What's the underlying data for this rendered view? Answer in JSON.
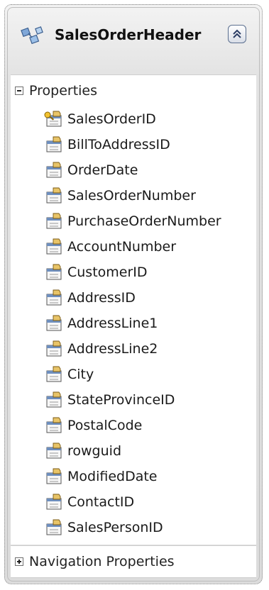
{
  "entity": {
    "title": "SalesOrderHeader",
    "icon": "entity-icon",
    "collapse_icon": "double-chevron-up-icon"
  },
  "properties_section": {
    "label": "Properties",
    "expanded": true,
    "items": [
      {
        "label": "SalesOrderID",
        "icon": "key-property-icon"
      },
      {
        "label": "BillToAddressID",
        "icon": "property-icon"
      },
      {
        "label": "OrderDate",
        "icon": "property-icon"
      },
      {
        "label": "SalesOrderNumber",
        "icon": "property-icon"
      },
      {
        "label": "PurchaseOrderNumber",
        "icon": "property-icon"
      },
      {
        "label": "AccountNumber",
        "icon": "property-icon"
      },
      {
        "label": "CustomerID",
        "icon": "property-icon"
      },
      {
        "label": "AddressID",
        "icon": "property-icon"
      },
      {
        "label": "AddressLine1",
        "icon": "property-icon"
      },
      {
        "label": "AddressLine2",
        "icon": "property-icon"
      },
      {
        "label": "City",
        "icon": "property-icon"
      },
      {
        "label": "StateProvinceID",
        "icon": "property-icon"
      },
      {
        "label": "PostalCode",
        "icon": "property-icon"
      },
      {
        "label": "rowguid",
        "icon": "property-icon"
      },
      {
        "label": "ModifiedDate",
        "icon": "property-icon"
      },
      {
        "label": "ContactID",
        "icon": "property-icon"
      },
      {
        "label": "SalesPersonID",
        "icon": "property-icon"
      }
    ]
  },
  "navigation_section": {
    "label": "Navigation Properties",
    "expanded": false
  }
}
